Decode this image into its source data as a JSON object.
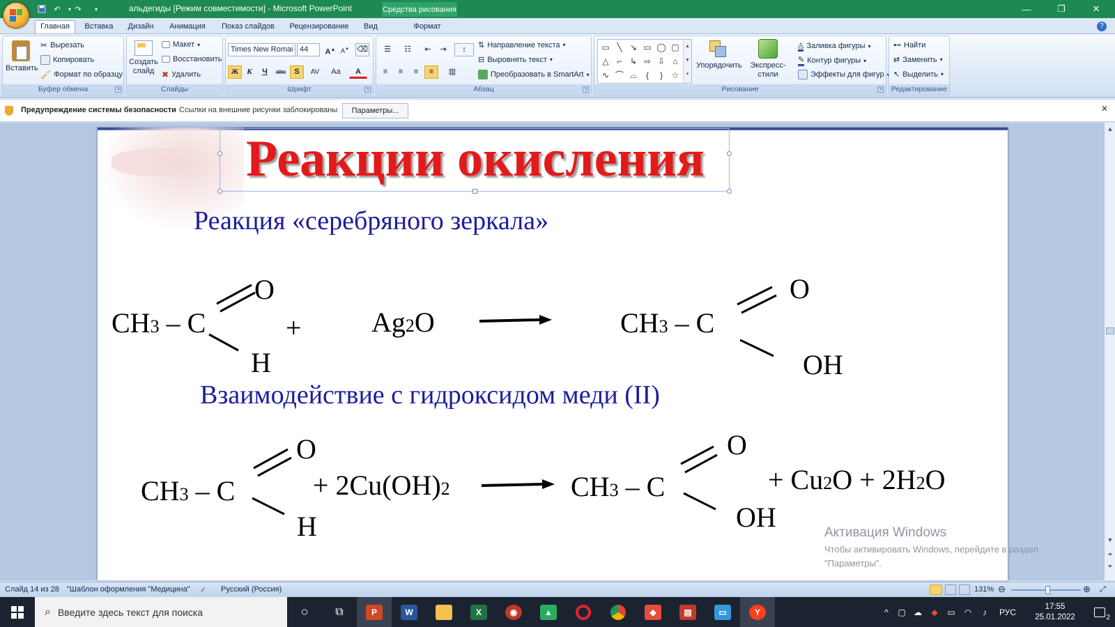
{
  "window": {
    "title": "альдегиды [Режим совместимости] - Microsoft PowerPoint",
    "context_tab_title": "Средства рисования",
    "minimize": "—",
    "maximize": "❐",
    "close": "✕"
  },
  "tabs": [
    "Главная",
    "Вставка",
    "Дизайн",
    "Анимация",
    "Показ слайдов",
    "Рецензирование",
    "Вид",
    "Формат"
  ],
  "active_tab": "Главная",
  "ribbon": {
    "clipboard": {
      "label": "Буфер обмена",
      "paste": "Вставить",
      "cut": "Вырезать",
      "copy": "Копировать",
      "format_painter": "Формат по образцу"
    },
    "slides": {
      "label": "Слайды",
      "new_slide_1": "Создать",
      "new_slide_2": "слайд",
      "layout": "Макет",
      "reset": "Восстановить",
      "delete": "Удалить"
    },
    "font": {
      "label": "Шрифт",
      "name": "Times New Romai",
      "size": "44",
      "bold": "Ж",
      "italic": "К",
      "underline": "Ч",
      "strike": "abc",
      "shadow": "S",
      "spacing": "AV",
      "case": "Aa",
      "color": "A"
    },
    "paragraph": {
      "label": "Абзац",
      "text_direction": "Направление текста",
      "align_text": "Выровнять текст",
      "smartart": "Преобразовать в SmartArt"
    },
    "drawing": {
      "label": "Рисование",
      "arrange": "Упорядочить",
      "quick_styles": "Экспресс-стили",
      "fill": "Заливка фигуры",
      "outline": "Контур фигуры",
      "effects": "Эффекты для фигур"
    },
    "editing": {
      "label": "Редактирование",
      "find": "Найти",
      "replace": "Заменить",
      "select": "Выделить"
    }
  },
  "security_bar": {
    "title": "Предупреждение системы безопасности",
    "message": "Ссылки на внешние рисунки заблокированы",
    "button": "Параметры..."
  },
  "slide": {
    "title": "Реакции окисления",
    "subtitle1": "Реакция «серебряного зеркала»",
    "subtitle2": "Взаимодействие с гидроксидом меди (II)",
    "eq1": {
      "ch3": "CH",
      "ch3_sub": "3",
      "dash_c": " – C",
      "o": "O",
      "h": "H",
      "plus": "+",
      "reagent": "Ag",
      "reagent_sub": "2",
      "reagent_tail": "O",
      "p_ch3": "CH",
      "p_ch3_sub": "3",
      "p_dash": " – ",
      "p_c": " C",
      "p_o": "O",
      "p_oh": "OH"
    },
    "eq2": {
      "ch3": "CH",
      "ch3_sub": "3",
      "dash_c": " – C",
      "o": "O",
      "h": "H",
      "reagent": "+ 2Cu(OH)",
      "reagent_sub": "2",
      "p_ch3": "CH",
      "p_ch3_sub": "3",
      "p_dash_c": " – C",
      "p_o": "O",
      "p_oh": "OH",
      "products_a": "+ Cu",
      "products_a_sub": "2",
      "products_b": "O + 2H",
      "products_b_sub": "2",
      "products_c": "O"
    }
  },
  "watermark": {
    "title": "Активация Windows",
    "line1": "Чтобы активировать Windows, перейдите в раздел",
    "line2": "\"Параметры\"."
  },
  "status": {
    "slide": "Слайд 14 из 28",
    "theme": "\"Шаблон оформления \"Медицина\"",
    "language": "Русский (Россия)",
    "zoom": "131%"
  },
  "taskbar": {
    "search_placeholder": "Введите здесь текст для поиска",
    "lang": "РУС",
    "time": "17:55",
    "date": "25.01.2022",
    "notifications": "2"
  },
  "colors": {
    "titlebar": "#1c8a52",
    "title_red": "#e31a1a",
    "subtitle_blue": "#1c1c9e"
  }
}
